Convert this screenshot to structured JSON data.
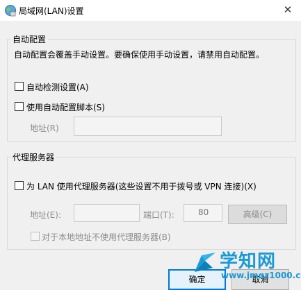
{
  "window": {
    "title": "局域网(LAN)设置",
    "close_glyph": "✕"
  },
  "auto_config": {
    "legend": "自动配置",
    "description": "自动配置会覆盖手动设置。要确保使用手动设置，请禁用自动配置。",
    "auto_detect_label": "自动检测设置(A)",
    "auto_detect_checked": false,
    "use_script_label": "使用自动配置脚本(S)",
    "use_script_checked": false,
    "address_label": "地址(R)",
    "address_value": ""
  },
  "proxy": {
    "legend": "代理服务器",
    "use_proxy_label": "为 LAN 使用代理服务器(这些设置不用于拨号或 VPN 连接)(X)",
    "use_proxy_checked": false,
    "address_label": "地址(E):",
    "address_value": "",
    "port_label": "端口(T):",
    "port_value": "80",
    "advanced_button": "高级(C)",
    "bypass_local_label": "对于本地地址不使用代理服务器(B)",
    "bypass_local_checked": false
  },
  "buttons": {
    "ok": "确定",
    "cancel": "取消"
  },
  "watermark": {
    "title": "学知网",
    "url": "www.jmqz1000.com",
    "color": "#1a9ad6"
  },
  "colors": {
    "accent": "#0078d7",
    "disabled_text": "#8c8c8c"
  }
}
